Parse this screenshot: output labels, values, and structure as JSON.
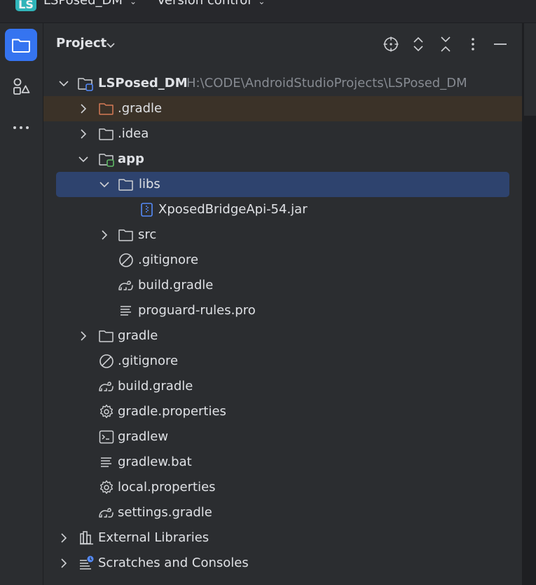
{
  "titlebar": {
    "logo_text": "LS",
    "project_name": "LSPosed_DM",
    "vcs_label": "Version control"
  },
  "header": {
    "title": "Project"
  },
  "tree": {
    "root_name": "LSPosed_DM",
    "root_path": "H:\\CODE\\AndroidStudioProjects\\LSPosed_DM",
    "items": [
      {
        "label": ".gradle"
      },
      {
        "label": ".idea"
      },
      {
        "label": "app"
      },
      {
        "label": "libs"
      },
      {
        "label": "XposedBridgeApi-54.jar"
      },
      {
        "label": "src"
      },
      {
        "label": ".gitignore"
      },
      {
        "label": "build.gradle"
      },
      {
        "label": "proguard-rules.pro"
      },
      {
        "label": "gradle"
      },
      {
        "label": ".gitignore"
      },
      {
        "label": "build.gradle"
      },
      {
        "label": "gradle.properties"
      },
      {
        "label": "gradlew"
      },
      {
        "label": "gradlew.bat"
      },
      {
        "label": "local.properties"
      },
      {
        "label": "settings.gradle"
      },
      {
        "label": "External Libraries"
      },
      {
        "label": "Scratches and Consoles"
      }
    ]
  },
  "colors": {
    "accent": "#3574f0",
    "selection": "#2e436e",
    "gradle_folder_icon": "#d67a56",
    "module_badge": "#5fb865"
  }
}
